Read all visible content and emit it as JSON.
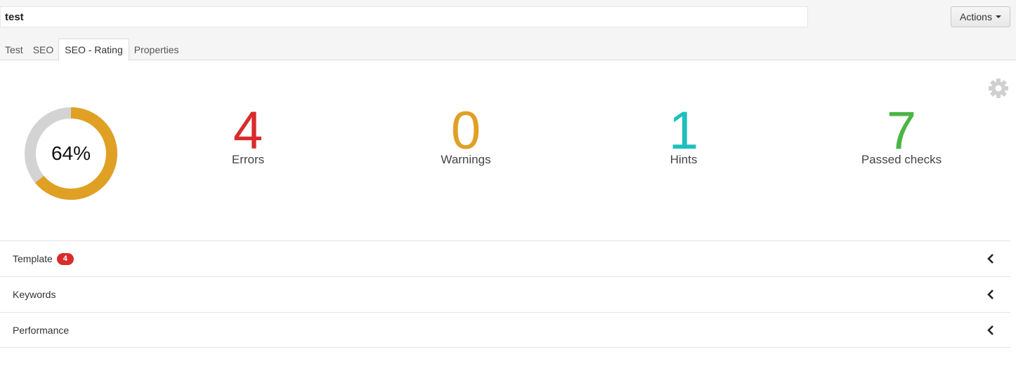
{
  "header": {
    "name_value": "test",
    "actions_label": "Actions"
  },
  "tabs": [
    {
      "label": "Test",
      "active": false
    },
    {
      "label": "SEO",
      "active": false
    },
    {
      "label": "SEO - Rating",
      "active": true
    },
    {
      "label": "Properties",
      "active": false
    }
  ],
  "rating": {
    "percent": 64,
    "percent_label": "64%",
    "arc_color": "#e0a024",
    "track_color": "#d3d3d3"
  },
  "stats": {
    "errors": {
      "value": "4",
      "label": "Errors",
      "color": "#d82c2c"
    },
    "warnings": {
      "value": "0",
      "label": "Warnings",
      "color": "#e0a024"
    },
    "hints": {
      "value": "1",
      "label": "Hints",
      "color": "#1ec0bd"
    },
    "passed": {
      "value": "7",
      "label": "Passed checks",
      "color": "#4bb543"
    }
  },
  "sections": [
    {
      "label": "Template",
      "badge": "4"
    },
    {
      "label": "Keywords"
    },
    {
      "label": "Performance"
    }
  ],
  "icons": {
    "settings": "gear-icon",
    "dropdown": "caret-down-icon",
    "collapse": "chevron-left-icon"
  }
}
